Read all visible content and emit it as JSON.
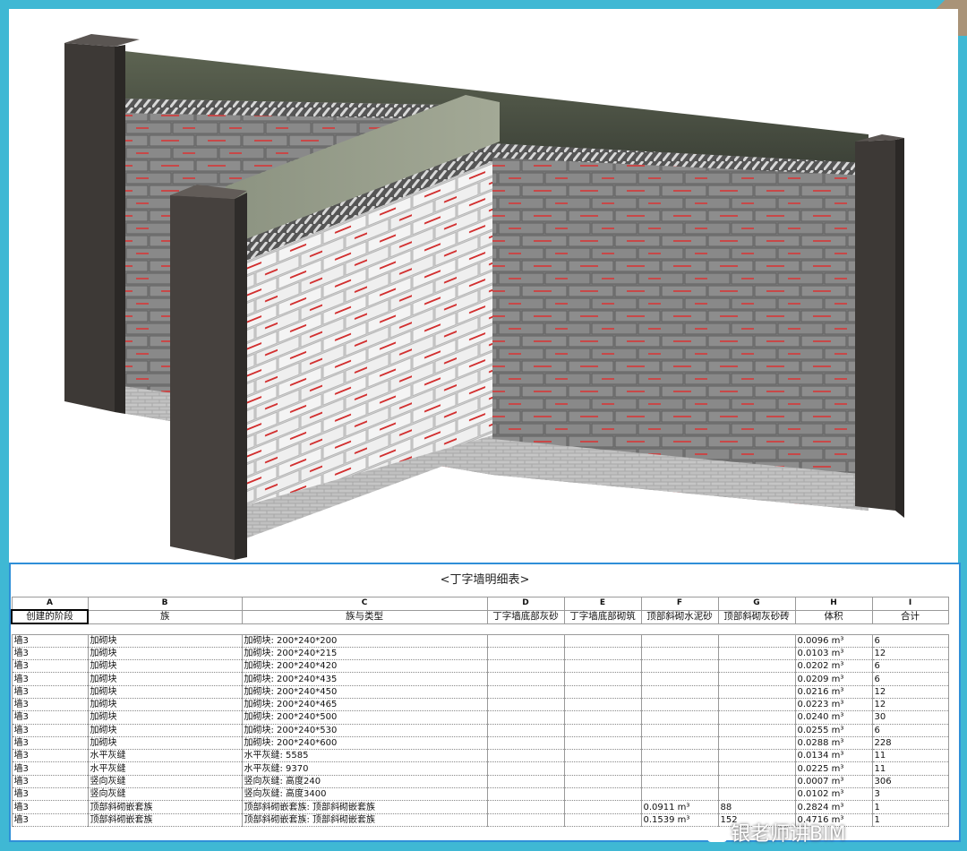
{
  "schedule": {
    "title": "<丁字墙明细表>",
    "column_letters": [
      "A",
      "B",
      "C",
      "D",
      "E",
      "F",
      "G",
      "H",
      "I"
    ],
    "column_headers": [
      "创建的阶段",
      "族",
      "族与类型",
      "丁字墙底部灰砂",
      "丁字墙底部砌筑",
      "顶部斜砌水泥砂",
      "顶部斜砌灰砂砖",
      "体积",
      "合计"
    ],
    "rows": [
      [
        "墙3",
        "加砌块",
        "加砌块: 200*240*200",
        "",
        "",
        "",
        "",
        "0.0096 m³",
        "6"
      ],
      [
        "墙3",
        "加砌块",
        "加砌块: 200*240*215",
        "",
        "",
        "",
        "",
        "0.0103 m³",
        "12"
      ],
      [
        "墙3",
        "加砌块",
        "加砌块: 200*240*420",
        "",
        "",
        "",
        "",
        "0.0202 m³",
        "6"
      ],
      [
        "墙3",
        "加砌块",
        "加砌块: 200*240*435",
        "",
        "",
        "",
        "",
        "0.0209 m³",
        "6"
      ],
      [
        "墙3",
        "加砌块",
        "加砌块: 200*240*450",
        "",
        "",
        "",
        "",
        "0.0216 m³",
        "12"
      ],
      [
        "墙3",
        "加砌块",
        "加砌块: 200*240*465",
        "",
        "",
        "",
        "",
        "0.0223 m³",
        "12"
      ],
      [
        "墙3",
        "加砌块",
        "加砌块: 200*240*500",
        "",
        "",
        "",
        "",
        "0.0240 m³",
        "30"
      ],
      [
        "墙3",
        "加砌块",
        "加砌块: 200*240*530",
        "",
        "",
        "",
        "",
        "0.0255 m³",
        "6"
      ],
      [
        "墙3",
        "加砌块",
        "加砌块: 200*240*600",
        "",
        "",
        "",
        "",
        "0.0288 m³",
        "228"
      ],
      [
        "墙3",
        "水平灰缝",
        "水平灰缝: 5585",
        "",
        "",
        "",
        "",
        "0.0134 m³",
        "11"
      ],
      [
        "墙3",
        "水平灰缝",
        "水平灰缝: 9370",
        "",
        "",
        "",
        "",
        "0.0225 m³",
        "11"
      ],
      [
        "墙3",
        "竖向灰缝",
        "竖向灰缝: 高度240",
        "",
        "",
        "",
        "",
        "0.0007 m³",
        "306"
      ],
      [
        "墙3",
        "竖向灰缝",
        "竖向灰缝: 高度3400",
        "",
        "",
        "",
        "",
        "0.0102 m³",
        "3"
      ],
      [
        "墙3",
        "顶部斜砌嵌套族",
        "顶部斜砌嵌套族: 顶部斜砌嵌套族",
        "",
        "",
        "0.0911 m³",
        "88",
        "0.2824 m³",
        "1"
      ],
      [
        "墙3",
        "顶部斜砌嵌套族",
        "顶部斜砌嵌套族: 顶部斜砌嵌套族",
        "",
        "",
        "0.1539 m³",
        "152",
        "0.4716 m³",
        "1"
      ]
    ]
  },
  "watermark": {
    "text": "银老师讲BIM"
  },
  "colors": {
    "background": "#3fb8d4",
    "panel_border": "#2f8fd8",
    "concrete": "#4a4542",
    "block_grey": "#8c8c8c",
    "block_white": "#f2f2f2",
    "block_label": "#d23030"
  }
}
